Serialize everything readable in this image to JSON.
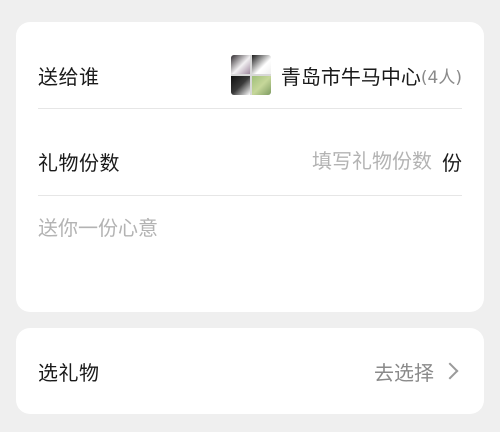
{
  "recipient_row": {
    "label": "送给谁",
    "group_name": "青岛市牛马中心",
    "member_count": "(4人)"
  },
  "quantity_row": {
    "label": "礼物份数",
    "placeholder": "填写礼物份数",
    "unit": "份"
  },
  "message": {
    "placeholder": "送你一份心意"
  },
  "gift_row": {
    "label": "选礼物",
    "action": "去选择"
  }
}
